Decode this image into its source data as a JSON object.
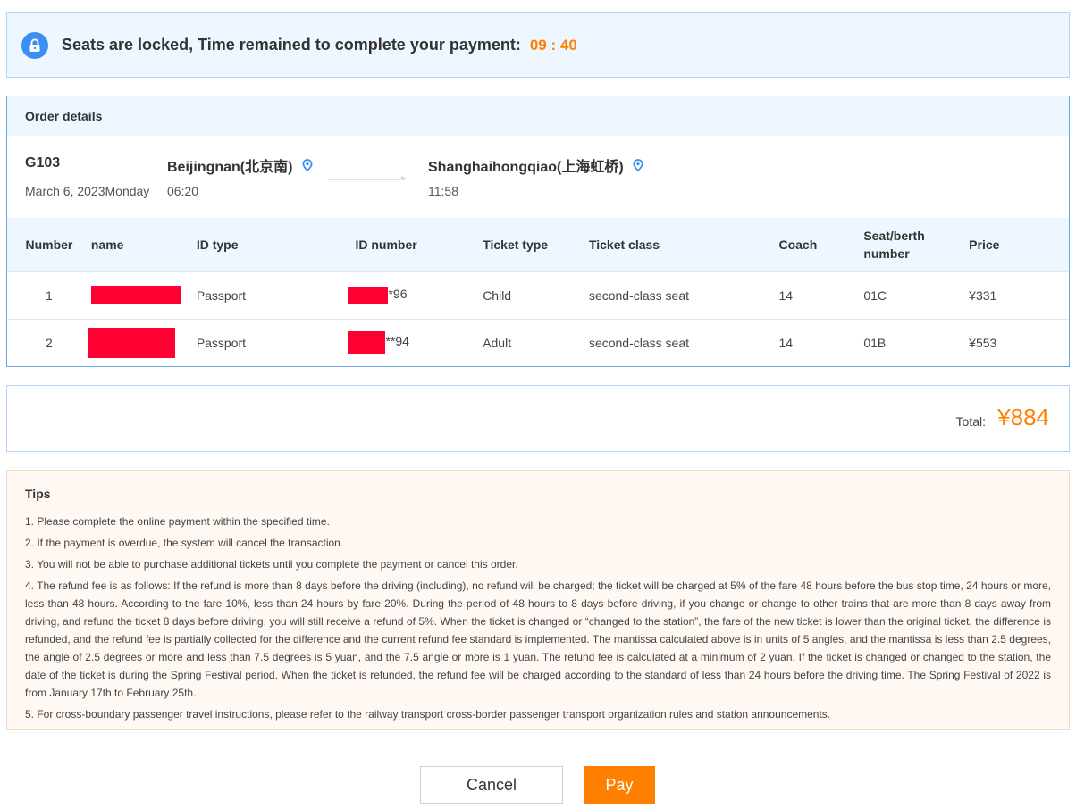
{
  "banner": {
    "icon": "lock-icon",
    "text": "Seats are locked, Time remained to complete your payment:",
    "timer": "09 : 40"
  },
  "order": {
    "header": "Order details",
    "train": "G103",
    "date": "March 6, 2023Monday",
    "from_station": "Beijingnan(北京南)",
    "depart_time": "06:20",
    "to_station": "Shanghaihongqiao(上海虹桥)",
    "arrive_time": "11:58",
    "columns": [
      "Number",
      "name",
      "ID type",
      "ID number",
      "Ticket type",
      "Ticket class",
      "Coach",
      "Seat/berth number",
      "Price"
    ],
    "passengers": [
      {
        "number": "1",
        "id_type": "Passport",
        "id_suffix": "*96",
        "ticket_type": "Child",
        "ticket_class": "second-class seat",
        "coach": "14",
        "seat": "01C",
        "price": "¥331"
      },
      {
        "number": "2",
        "id_type": "Passport",
        "id_suffix": "**94",
        "ticket_type": "Adult",
        "ticket_class": "second-class seat",
        "coach": "14",
        "seat": "01B",
        "price": "¥553"
      }
    ]
  },
  "total": {
    "label": "Total:",
    "value": "¥884"
  },
  "tips": {
    "title": "Tips",
    "items": [
      "1. Please complete the online payment within the specified time.",
      "2. If the payment is overdue, the system will cancel the transaction.",
      "3. You will not be able to purchase additional tickets until you complete the payment or cancel this order.",
      "4. The refund fee is as follows: If the refund is more than 8 days before the driving (including), no refund will be charged; the ticket will be charged at 5% of the fare 48 hours before the bus stop time, 24 hours or more, less than 48 hours. According to the fare 10%, less than 24 hours by fare 20%. During the period of 48 hours to 8 days before driving, if you change or change to other trains that are more than 8 days away from driving, and refund the ticket 8 days before driving, you will still receive a refund of 5%. When the ticket is changed or “changed to the station”, the fare of the new ticket is lower than the original ticket, the difference is refunded, and the refund fee is partially collected for the difference and the current refund fee standard is implemented. The mantissa calculated above is in units of 5 angles, and the mantissa is less than 2.5 degrees, the angle of 2.5 degrees or more and less than 7.5 degrees is 5 yuan, and the 7.5 angle or more is 1 yuan. The refund fee is calculated at a minimum of 2 yuan. If the ticket is changed or changed to the station, the date of the ticket is during the Spring Festival period. When the ticket is refunded, the refund fee will be charged according to the standard of less than 24 hours before the driving time. The Spring Festival of 2022 is from January 17th to February 25th.",
      "5. For cross-boundary passenger travel instructions, please refer to the railway transport cross-border passenger transport organization rules and station announcements."
    ]
  },
  "buttons": {
    "cancel": "Cancel",
    "pay": "Pay"
  },
  "colors": {
    "accent": "#ff8000",
    "primary_blue": "#3b8ff0",
    "redaction": "#ff0033"
  }
}
